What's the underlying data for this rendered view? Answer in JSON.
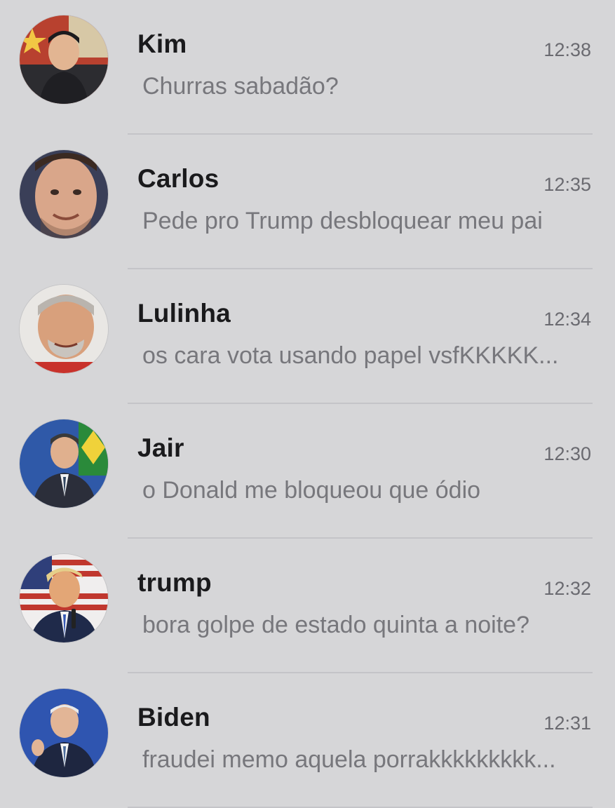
{
  "chats": [
    {
      "name": "Kim",
      "time": "12:38",
      "message": "Churras sabadão?",
      "avatar_icon": "kim-avatar-photo"
    },
    {
      "name": "Carlos",
      "time": "12:35",
      "message": "Pede pro Trump desbloquear meu pai",
      "avatar_icon": "carlos-avatar-photo"
    },
    {
      "name": "Lulinha",
      "time": "12:34",
      "message": "os cara vota usando papel vsfKKKKK...",
      "avatar_icon": "lulinha-avatar-photo"
    },
    {
      "name": "Jair",
      "time": "12:30",
      "message": "o Donald me bloqueou que ódio",
      "avatar_icon": "jair-avatar-photo"
    },
    {
      "name": "trump",
      "time": "12:32",
      "message": "bora golpe de estado quinta a noite?",
      "avatar_icon": "trump-avatar-photo"
    },
    {
      "name": "Biden",
      "time": "12:31",
      "message": "fraudei memo aquela porrakkkkkkkkk...",
      "avatar_icon": "biden-avatar-photo"
    }
  ],
  "colors": {
    "background": "#d6d6d8",
    "name_text": "#1a1a1c",
    "message_text": "#77777c",
    "time_text": "#6a6a70",
    "divider": "#c4c4c8"
  }
}
